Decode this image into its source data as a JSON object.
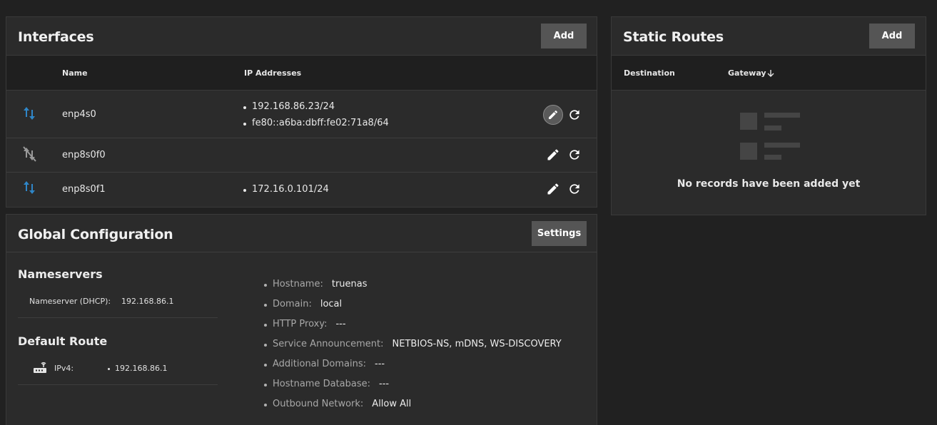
{
  "interfaces": {
    "title": "Interfaces",
    "add_label": "Add",
    "columns": {
      "name": "Name",
      "ip": "IP Addresses"
    },
    "rows": [
      {
        "name": "enp4s0",
        "status_icon": "link-up-arrows-icon",
        "ips": [
          "192.168.86.23/24",
          "fe80::a6ba:dbff:fe02:71a8/64"
        ]
      },
      {
        "name": "enp8s0f0",
        "status_icon": "link-down-icon",
        "ips": []
      },
      {
        "name": "enp8s0f1",
        "status_icon": "link-up-arrows-icon",
        "ips": [
          "172.16.0.101/24"
        ]
      }
    ]
  },
  "static_routes": {
    "title": "Static Routes",
    "add_label": "Add",
    "columns": {
      "destination": "Destination",
      "gateway": "Gateway"
    },
    "empty_text": "No records have been added yet"
  },
  "global_config": {
    "title": "Global Configuration",
    "settings_label": "Settings",
    "nameservers_title": "Nameservers",
    "nameserver_key": "Nameserver (DHCP):",
    "nameserver_value": "192.168.86.1",
    "default_route_title": "Default Route",
    "ipv4_key": "IPv4:",
    "ipv4_value": "192.168.86.1",
    "items": [
      {
        "key": "Hostname:",
        "value": "truenas"
      },
      {
        "key": "Domain:",
        "value": "local"
      },
      {
        "key": "HTTP Proxy:",
        "value": "---"
      },
      {
        "key": "Service Announcement:",
        "value": "NETBIOS-NS, mDNS, WS-DISCOVERY"
      },
      {
        "key": "Additional Domains:",
        "value": "---"
      },
      {
        "key": "Hostname Database:",
        "value": "---"
      },
      {
        "key": "Outbound Network:",
        "value": "Allow All"
      }
    ]
  },
  "colors": {
    "background": "#212121",
    "card": "#2b2b2b",
    "accent_blue": "#2f86c8",
    "button": "#555555"
  }
}
